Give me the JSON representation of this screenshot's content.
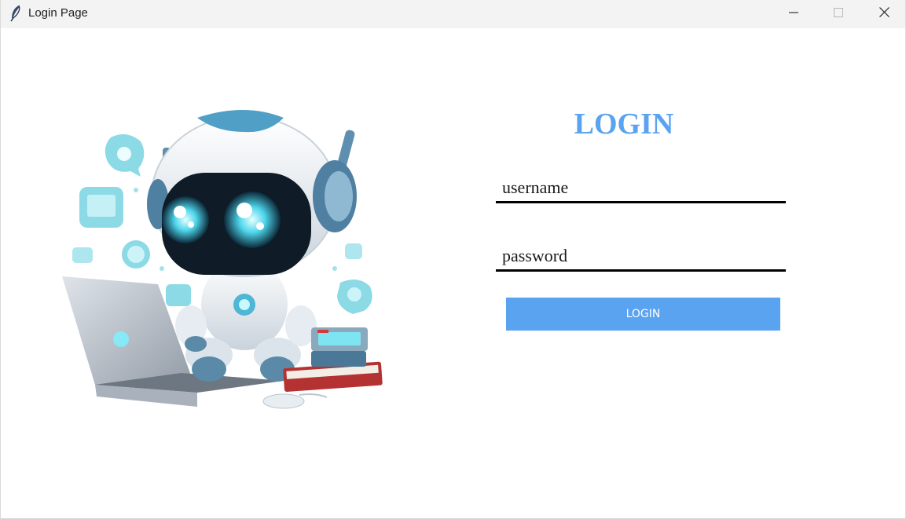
{
  "window": {
    "title": "Login Page",
    "icon": "feather-icon",
    "controls": [
      "minimize-icon",
      "maximize-icon",
      "close-icon"
    ]
  },
  "hero": {
    "image": "robot-with-laptop-illustration"
  },
  "login": {
    "heading": "LOGIN",
    "username_placeholder": "username",
    "username_value": "",
    "password_placeholder": "password",
    "password_value": "",
    "button_label": "LOGIN"
  },
  "colors": {
    "accent": "#5aa3f0",
    "titlebar": "#f3f3f3",
    "underline": "#000000"
  }
}
